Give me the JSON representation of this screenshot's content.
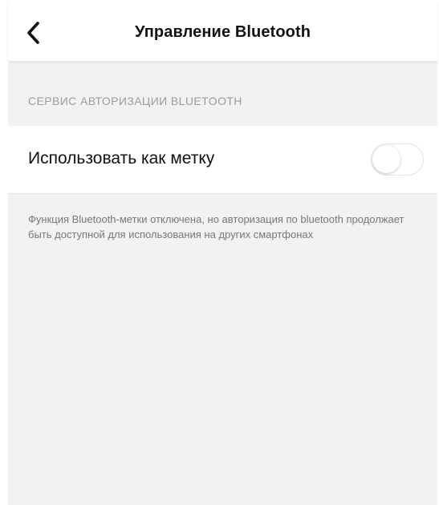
{
  "header": {
    "title": "Управление Bluetooth",
    "back_icon": "chevron-left-icon"
  },
  "section": {
    "header": "СЕРВИС АВТОРИЗАЦИИ BLUETOOTH",
    "cell_label": "Использовать как метку",
    "toggle_on": false
  },
  "footnote": "Функция Bluetooth-метки отключена, но авторизация по bluetooth продолжает быть доступной для использования на других смартфонах",
  "colors": {
    "background": "#f2f2f4",
    "surface": "#ffffff",
    "section_text": "#9b9ba0",
    "footnote_text": "#77777c"
  }
}
